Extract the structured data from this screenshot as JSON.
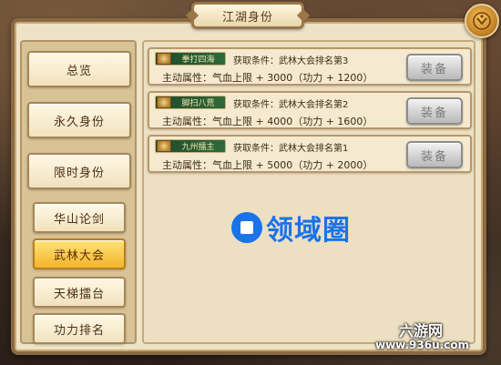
{
  "window": {
    "title": "江湖身份"
  },
  "sidebar": {
    "items": [
      {
        "label": "总览",
        "active": false
      },
      {
        "label": "永久身份",
        "active": false
      },
      {
        "label": "限时身份",
        "active": false
      },
      {
        "label": "华山论剑",
        "active": false
      },
      {
        "label": "武林大会",
        "active": true
      },
      {
        "label": "天梯擂台",
        "active": false
      },
      {
        "label": "功力排名",
        "active": false
      }
    ]
  },
  "identities": [
    {
      "badge": "拳打四海",
      "condition": "获取条件：武林大会排名第3",
      "attribute": "主动属性：气血上限 + 3000（功力 + 1200）",
      "button": "装备"
    },
    {
      "badge": "脚扫八荒",
      "condition": "获取条件：武林大会排名第2",
      "attribute": "主动属性：气血上限 + 4000（功力 + 1600）",
      "button": "装备"
    },
    {
      "badge": "九州擂主",
      "condition": "获取条件：武林大会排名第1",
      "attribute": "主动属性：气血上限 + 5000（功力 + 2000）",
      "button": "装备"
    }
  ],
  "watermark": {
    "brand": "领域圈",
    "site_name": "六游网",
    "site_url": "www.936u.com"
  },
  "icons": {
    "close": "close-emblem-icon",
    "badge_emblem": "title-emblem-icon",
    "watermark_logo": "brand-logo-icon"
  },
  "colors": {
    "active_tab": "#f4b42a",
    "badge_bg": "#2f6a3a",
    "watermark": "#1a73e8"
  }
}
